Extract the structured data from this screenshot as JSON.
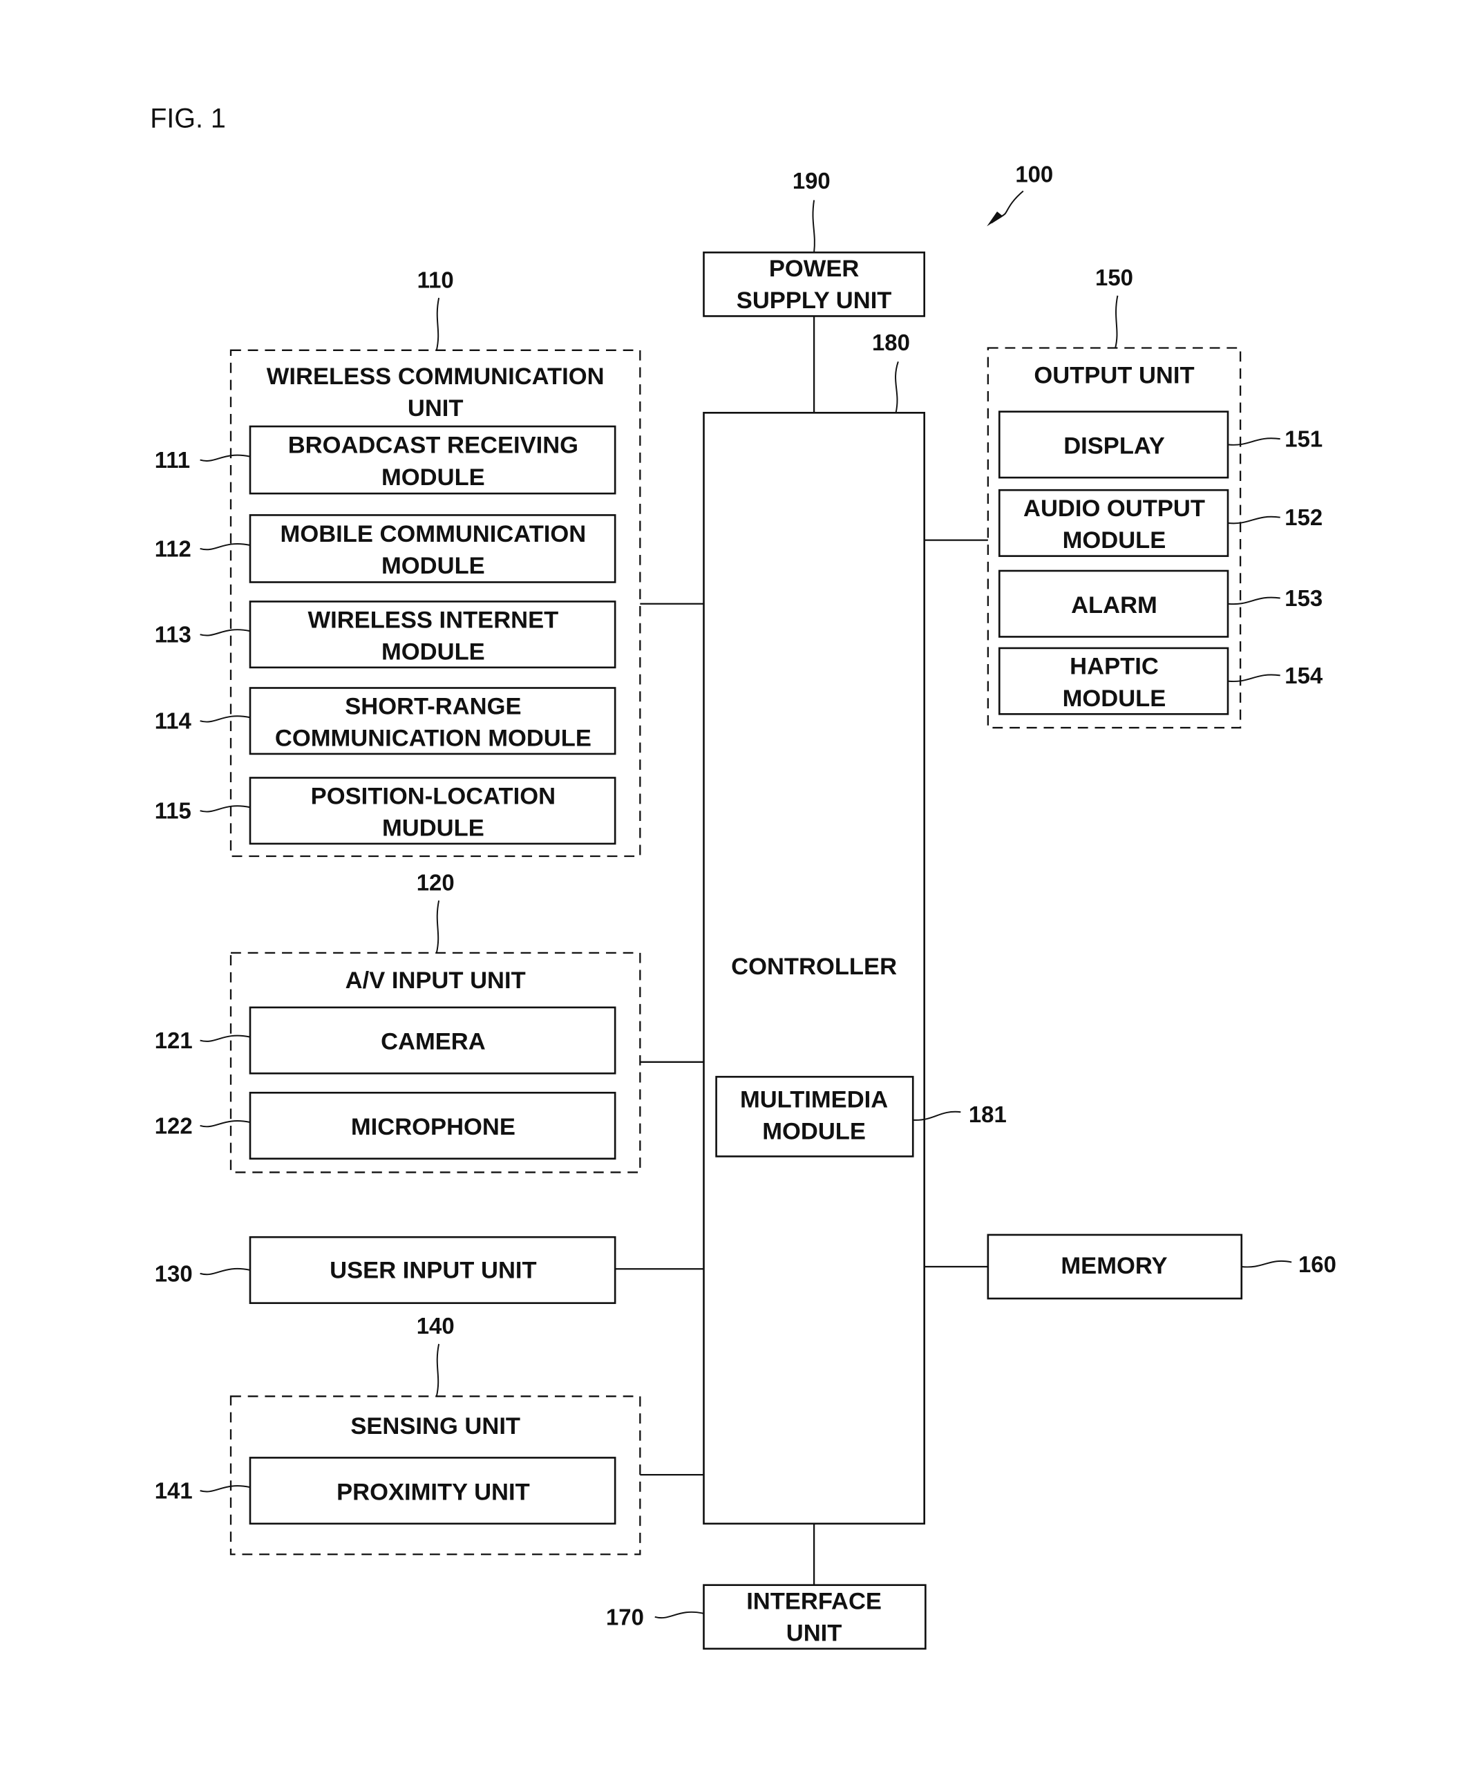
{
  "figure": {
    "title": "FIG. 1",
    "ref": "100"
  },
  "power_supply": {
    "ref": "190",
    "lines": [
      "POWER",
      "SUPPLY UNIT"
    ]
  },
  "controller": {
    "ref": "180",
    "label": "CONTROLLER",
    "multimedia": {
      "ref": "181",
      "lines": [
        "MULTIMEDIA",
        "MODULE"
      ]
    }
  },
  "wireless": {
    "ref": "110",
    "lines": [
      "WIRELESS COMMUNICATION",
      "UNIT"
    ],
    "modules": [
      {
        "ref": "111",
        "lines": [
          "BROADCAST RECEIVING",
          "MODULE"
        ]
      },
      {
        "ref": "112",
        "lines": [
          "MOBILE COMMUNICATION",
          "MODULE"
        ]
      },
      {
        "ref": "113",
        "lines": [
          "WIRELESS INTERNET",
          "MODULE"
        ]
      },
      {
        "ref": "114",
        "lines": [
          "SHORT-RANGE",
          "COMMUNICATION MODULE"
        ]
      },
      {
        "ref": "115",
        "lines": [
          "POSITION-LOCATION",
          "MUDULE"
        ]
      }
    ]
  },
  "av_input": {
    "ref": "120",
    "label": "A/V INPUT UNIT",
    "modules": [
      {
        "ref": "121",
        "label": "CAMERA"
      },
      {
        "ref": "122",
        "label": "MICROPHONE"
      }
    ]
  },
  "user_input": {
    "ref": "130",
    "label": "USER INPUT UNIT"
  },
  "sensing": {
    "ref": "140",
    "label": "SENSING UNIT",
    "modules": [
      {
        "ref": "141",
        "label": "PROXIMITY UNIT"
      }
    ]
  },
  "output": {
    "ref": "150",
    "label": "OUTPUT UNIT",
    "modules": [
      {
        "ref": "151",
        "lines": [
          "DISPLAY"
        ]
      },
      {
        "ref": "152",
        "lines": [
          "AUDIO OUTPUT",
          "MODULE"
        ]
      },
      {
        "ref": "153",
        "lines": [
          "ALARM"
        ]
      },
      {
        "ref": "154",
        "lines": [
          "HAPTIC",
          "MODULE"
        ]
      }
    ]
  },
  "memory": {
    "ref": "160",
    "label": "MEMORY"
  },
  "interface": {
    "ref": "170",
    "lines": [
      "INTERFACE",
      "UNIT"
    ]
  }
}
